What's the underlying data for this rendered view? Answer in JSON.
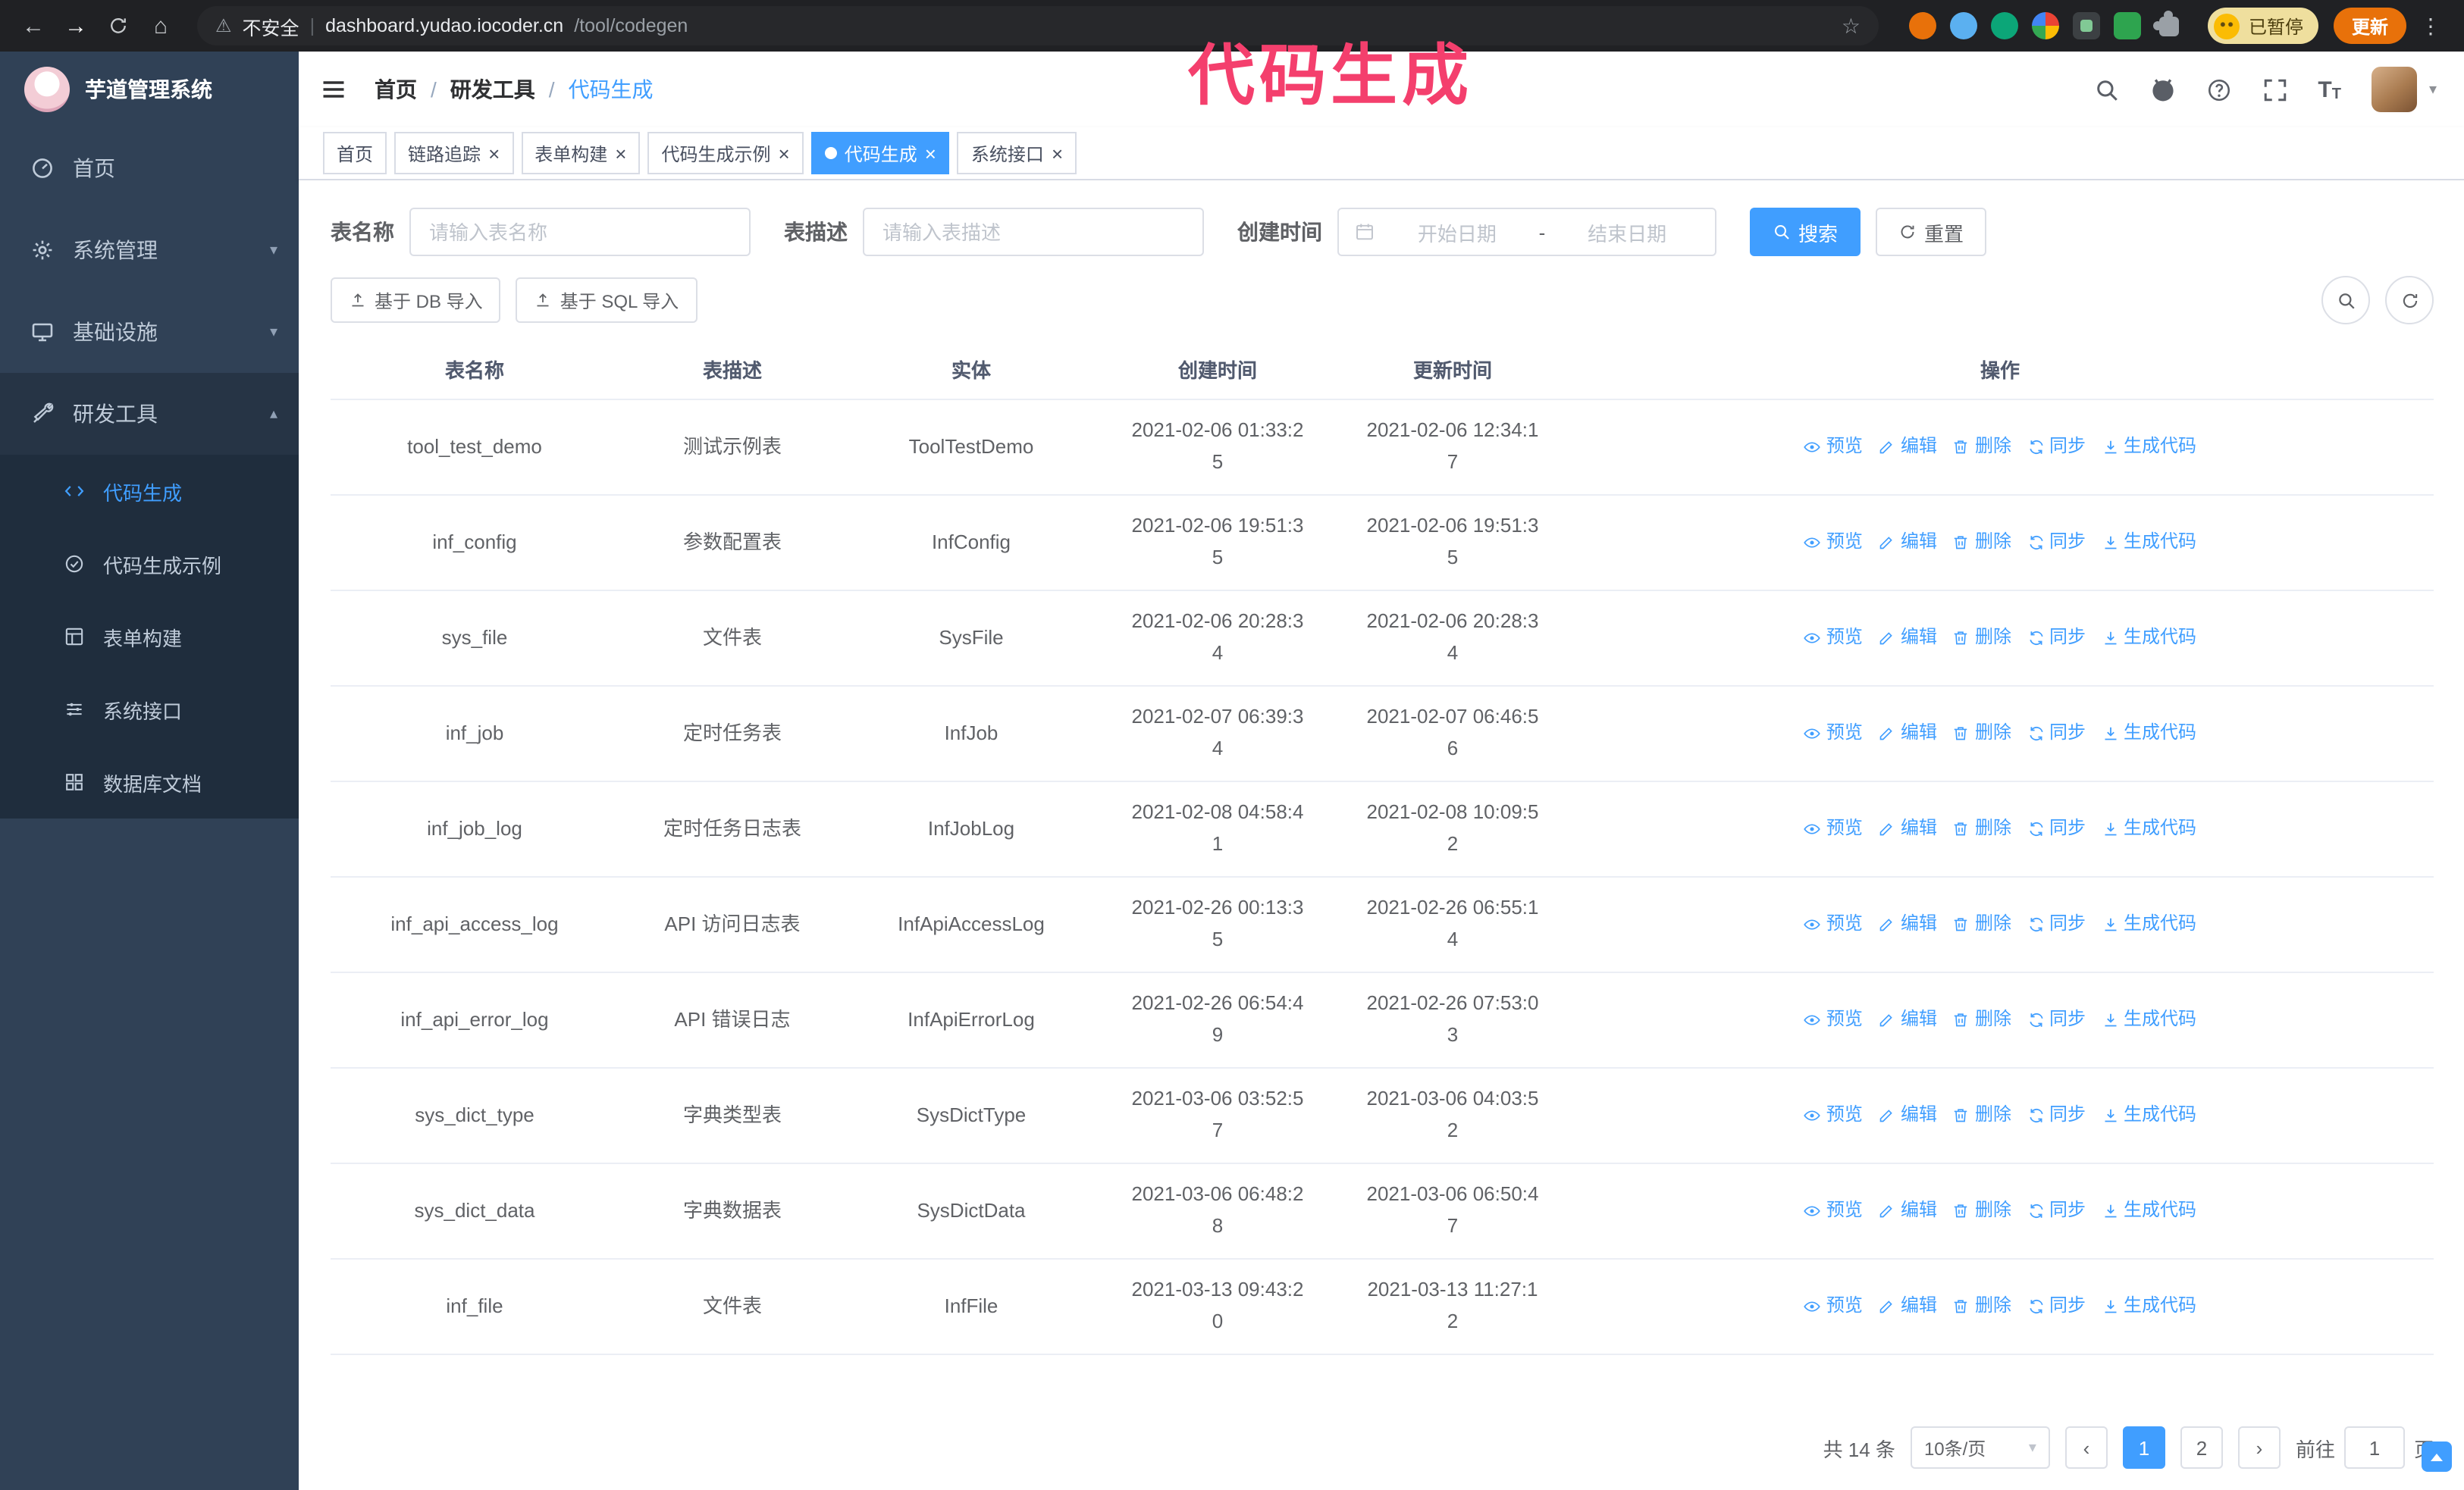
{
  "browser": {
    "security_label": "不安全",
    "separator": "|",
    "url_host": "dashboard.yudao.iocoder.cn",
    "url_path": "/tool/codegen",
    "paused_badge": "已暂停",
    "update_button": "更新"
  },
  "annotation": {
    "text": "代码生成",
    "color": "#f43f6d"
  },
  "sidebar": {
    "logo_title": "芋道管理系统",
    "items": [
      {
        "label": "首页"
      },
      {
        "label": "系统管理"
      },
      {
        "label": "基础设施"
      },
      {
        "label": "研发工具"
      }
    ],
    "sub_items": [
      {
        "label": "代码生成"
      },
      {
        "label": "代码生成示例"
      },
      {
        "label": "表单构建"
      },
      {
        "label": "系统接口"
      },
      {
        "label": "数据库文档"
      }
    ]
  },
  "header": {
    "breadcrumb": [
      {
        "label": "首页"
      },
      {
        "label": "研发工具"
      },
      {
        "label": "代码生成"
      }
    ],
    "separator": "/"
  },
  "tabs": [
    {
      "label": "首页"
    },
    {
      "label": "链路追踪"
    },
    {
      "label": "表单构建"
    },
    {
      "label": "代码生成示例"
    },
    {
      "label": "代码生成"
    },
    {
      "label": "系统接口"
    }
  ],
  "filters": {
    "table_name_label": "表名称",
    "table_name_placeholder": "请输入表名称",
    "table_desc_label": "表描述",
    "table_desc_placeholder": "请输入表描述",
    "create_time_label": "创建时间",
    "date_start_placeholder": "开始日期",
    "date_separator": "-",
    "date_end_placeholder": "结束日期",
    "search_button": "搜索",
    "reset_button": "重置"
  },
  "toolbar": {
    "import_db_button": "基于 DB 导入",
    "import_sql_button": "基于 SQL 导入"
  },
  "table": {
    "columns": [
      "表名称",
      "表描述",
      "实体",
      "创建时间",
      "更新时间",
      "操作"
    ],
    "actions": [
      "预览",
      "编辑",
      "删除",
      "同步",
      "生成代码"
    ],
    "rows": [
      {
        "name": "tool_test_demo",
        "desc": "测试示例表",
        "entity": "ToolTestDemo",
        "created": "2021-02-06 01:33:25",
        "updated": "2021-02-06 12:34:17"
      },
      {
        "name": "inf_config",
        "desc": "参数配置表",
        "entity": "InfConfig",
        "created": "2021-02-06 19:51:35",
        "updated": "2021-02-06 19:51:35"
      },
      {
        "name": "sys_file",
        "desc": "文件表",
        "entity": "SysFile",
        "created": "2021-02-06 20:28:34",
        "updated": "2021-02-06 20:28:34"
      },
      {
        "name": "inf_job",
        "desc": "定时任务表",
        "entity": "InfJob",
        "created": "2021-02-07 06:39:34",
        "updated": "2021-02-07 06:46:56"
      },
      {
        "name": "inf_job_log",
        "desc": "定时任务日志表",
        "entity": "InfJobLog",
        "created": "2021-02-08 04:58:41",
        "updated": "2021-02-08 10:09:52"
      },
      {
        "name": "inf_api_access_log",
        "desc": "API 访问日志表",
        "entity": "InfApiAccessLog",
        "created": "2021-02-26 00:13:35",
        "updated": "2021-02-26 06:55:14"
      },
      {
        "name": "inf_api_error_log",
        "desc": "API 错误日志",
        "entity": "InfApiErrorLog",
        "created": "2021-02-26 06:54:49",
        "updated": "2021-02-26 07:53:03"
      },
      {
        "name": "sys_dict_type",
        "desc": "字典类型表",
        "entity": "SysDictType",
        "created": "2021-03-06 03:52:57",
        "updated": "2021-03-06 04:03:52"
      },
      {
        "name": "sys_dict_data",
        "desc": "字典数据表",
        "entity": "SysDictData",
        "created": "2021-03-06 06:48:28",
        "updated": "2021-03-06 06:50:47"
      },
      {
        "name": "inf_file",
        "desc": "文件表",
        "entity": "InfFile",
        "created": "2021-03-13 09:43:20",
        "updated": "2021-03-13 11:27:12"
      }
    ]
  },
  "pagination": {
    "total": "共 14 条",
    "page_size": "10条/页",
    "page_1": "1",
    "page_2": "2",
    "goto_label": "前往",
    "goto_value": "1",
    "goto_suffix": "页"
  },
  "icons": {
    "back": "←",
    "forward": "→",
    "home": "⌂",
    "warning": "⚠",
    "star": "☆",
    "dots_vertical": "⋮",
    "close": "×",
    "caret_down": "▾",
    "caret_up": "▴",
    "prev": "‹",
    "next": "›",
    "font_size": "T"
  },
  "colors": {
    "primary": "#409eff",
    "sidebar_bg": "#304156",
    "submenu_bg": "#1f2d3d",
    "annotation": "#f43f6d",
    "update_button_bg": "#e8710a"
  }
}
